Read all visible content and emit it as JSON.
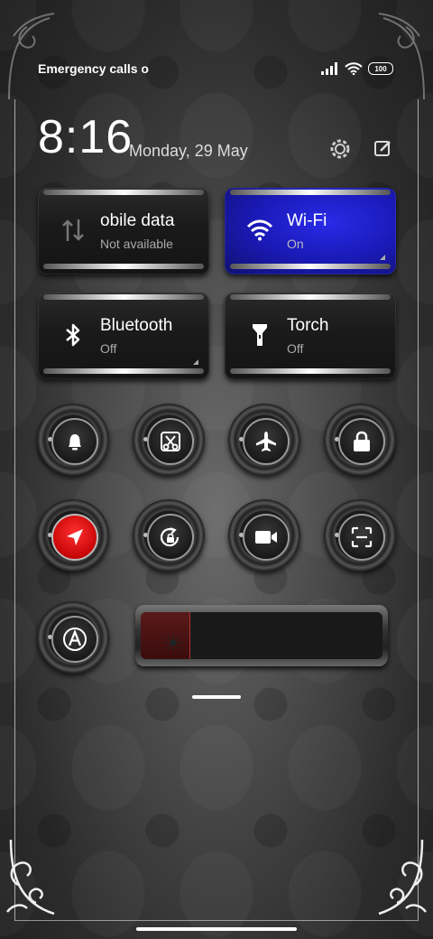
{
  "status_bar": {
    "carrier": "Emergency calls o",
    "battery": "100",
    "icons": [
      "signal-icon",
      "wifi-icon",
      "battery-icon"
    ]
  },
  "header": {
    "time": "8:16",
    "date": "Monday, 29 May",
    "icons": [
      "settings-icon",
      "edit-icon"
    ]
  },
  "tiles": [
    {
      "title": "obile data",
      "subtitle": "Not available",
      "icon": "mobile-data-icon",
      "state": "unavailable"
    },
    {
      "title": "Wi-Fi",
      "subtitle": "On",
      "icon": "wifi-icon",
      "state": "on",
      "color": "#1f1fd0"
    },
    {
      "title": "Bluetooth",
      "subtitle": "Off",
      "icon": "bluetooth-icon",
      "state": "off"
    },
    {
      "title": "Torch",
      "subtitle": "Off",
      "icon": "torch-icon",
      "state": "off"
    }
  ],
  "toggles": [
    {
      "icon": "bell-icon",
      "active": false
    },
    {
      "icon": "screenshot-icon",
      "active": false
    },
    {
      "icon": "airplane-icon",
      "active": false
    },
    {
      "icon": "lock-icon",
      "active": false
    },
    {
      "icon": "location-icon",
      "active": true,
      "color": "#e01414"
    },
    {
      "icon": "rotation-lock-icon",
      "active": false
    },
    {
      "icon": "screen-record-icon",
      "active": false
    },
    {
      "icon": "scanner-icon",
      "active": false
    },
    {
      "icon": "auto-brightness-icon",
      "active": false
    }
  ],
  "brightness": {
    "level": 0.2,
    "icon": "brightness-icon"
  }
}
